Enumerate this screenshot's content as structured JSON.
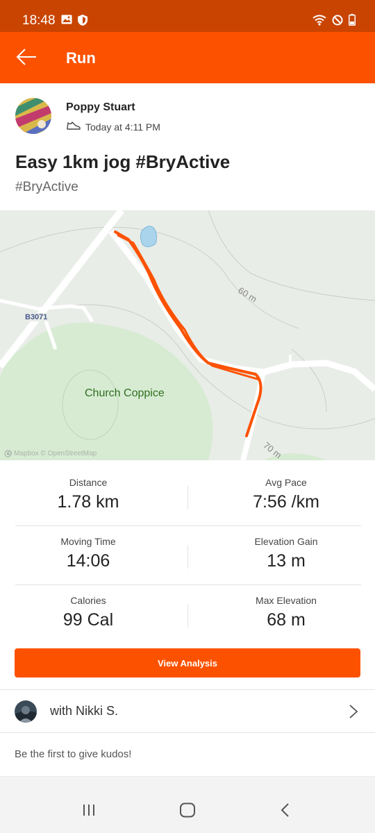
{
  "status_bar": {
    "time": "18:48",
    "left_icons": [
      "image-icon",
      "shield-icon"
    ],
    "right_icons": [
      "wifi-icon",
      "do-not-disturb-icon",
      "battery-icon"
    ]
  },
  "app_bar": {
    "title": "Run",
    "back_icon": "arrow-left-icon"
  },
  "activity": {
    "athlete_name": "Poppy Stuart",
    "sport_icon": "shoe-icon",
    "timestamp": "Today at 4:11 PM",
    "title": "Easy 1km jog #BryActive",
    "description": "#BryActive"
  },
  "map": {
    "road_label": "B3071",
    "place_label": "Church Coppice",
    "contour_labels": [
      "60 m",
      "70 m"
    ],
    "attribution": "© Mapbox © OpenStreetMap",
    "route_color": "#fc5200"
  },
  "stats": [
    {
      "left": {
        "label": "Distance",
        "value": "1.78 km"
      },
      "right": {
        "label": "Avg Pace",
        "value": "7:56 /km"
      }
    },
    {
      "left": {
        "label": "Moving Time",
        "value": "14:06"
      },
      "right": {
        "label": "Elevation Gain",
        "value": "13 m"
      }
    },
    {
      "left": {
        "label": "Calories",
        "value": "99 Cal"
      },
      "right": {
        "label": "Max Elevation",
        "value": "68 m"
      }
    }
  ],
  "actions": {
    "view_analysis": "View Analysis"
  },
  "with_athletes": {
    "text": "with Nikki S.",
    "chevron_icon": "chevron-right-icon"
  },
  "kudos": {
    "prompt": "Be the first to give kudos!"
  },
  "nav_bar": {
    "icons": [
      "recents-icon",
      "home-icon",
      "back-icon"
    ]
  },
  "colors": {
    "brand": "#fc5200",
    "status_bar": "#c94400"
  }
}
